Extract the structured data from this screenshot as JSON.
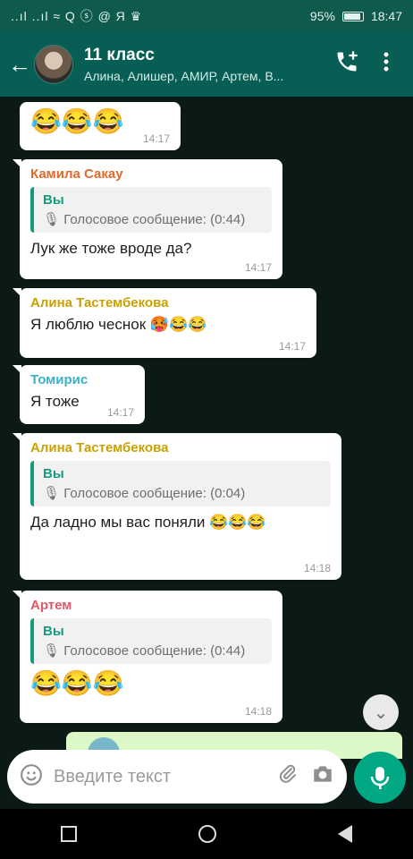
{
  "status_bar": {
    "left_icons": "..ıl ..ıl ≈ Q ⓢ @ Я ♛",
    "battery": "95%",
    "time": "18:47"
  },
  "header": {
    "back_icon": "arrow-left-icon",
    "title": "11 класс",
    "subtitle": "Алина, Алишер, АМИР, Артем, В...",
    "call_icon": "add-call-icon",
    "menu_icon": "more-vert-icon"
  },
  "messages": [
    {
      "emoji": "😂😂😂",
      "time": "14:17"
    },
    {
      "sender": "Камила Сакау",
      "sender_color": "#e06a2c",
      "quote_name": "Вы",
      "quote_text": "🎙 Голосовое сообщение: (0:44)",
      "text": "Лук же тоже вроде да?",
      "time": "14:17"
    },
    {
      "sender": "Алина Тастембекова",
      "sender_color": "#c9a200",
      "text": "Я люблю чеснок 🥵😂😂",
      "time": "14:17"
    },
    {
      "sender": "Томирис",
      "sender_color": "#3bb2c9",
      "text": "Я тоже",
      "time": "14:17"
    },
    {
      "sender": "Алина Тастембекова",
      "sender_color": "#c9a200",
      "quote_name": "Вы",
      "quote_text": "🎙 Голосовое сообщение: (0:04)",
      "text": "Да ладно мы вас поняли 😂😂😂",
      "time": "14:18"
    },
    {
      "sender": "Артем",
      "sender_color": "#e0596b",
      "quote_name": "Вы",
      "quote_text": "🎙 Голосовое сообщение: (0:44)",
      "emoji": "😂😂😂",
      "time": "14:18"
    }
  ],
  "composer": {
    "placeholder": "Введите текст",
    "emoji_icon": "emoji-icon",
    "attach_icon": "paperclip-icon",
    "camera_icon": "camera-icon",
    "mic_icon": "mic-icon"
  },
  "colors": {
    "accent": "#075e54",
    "quote_bar": "#139a7d",
    "mic_button": "#00a884"
  }
}
